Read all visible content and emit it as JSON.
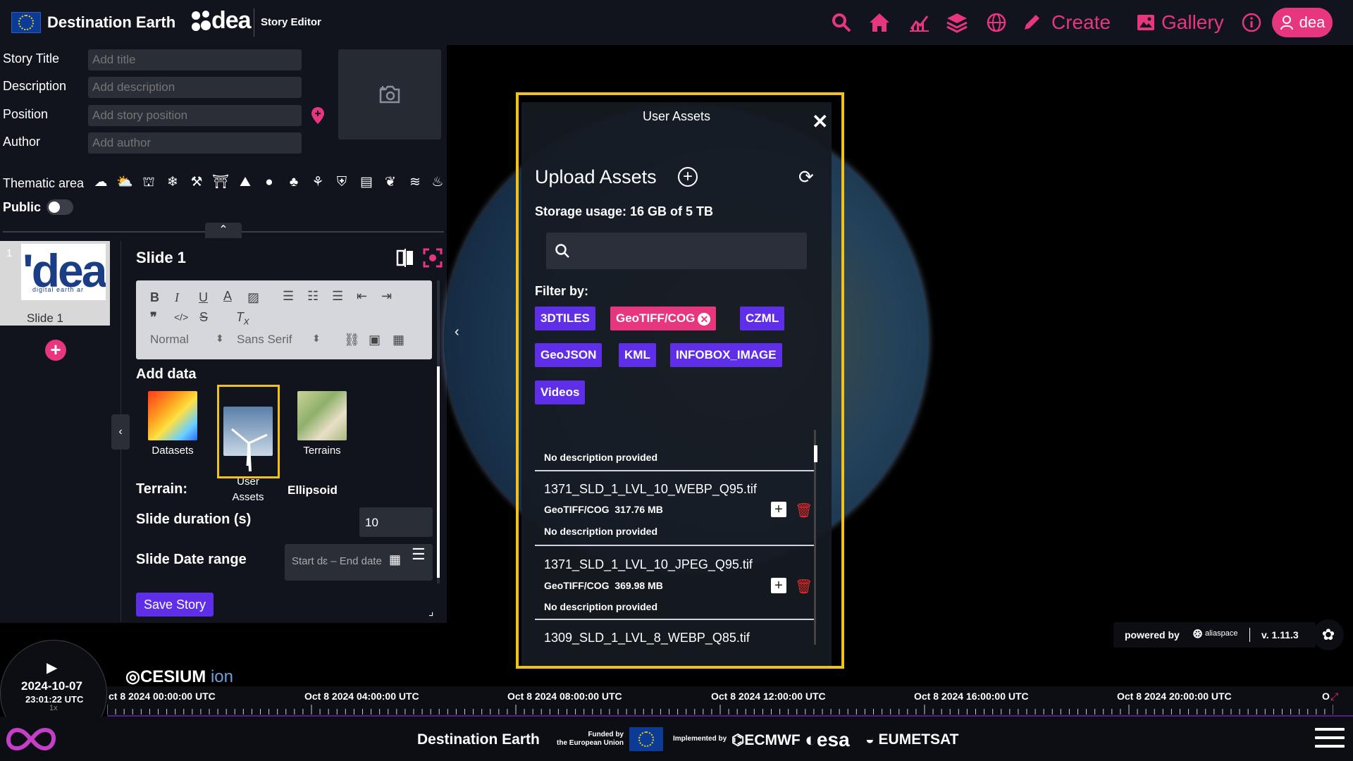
{
  "header": {
    "brand_title": "Destination Earth",
    "logo_text": "dea",
    "app_label": "Story Editor",
    "create_label": "Create",
    "gallery_label": "Gallery",
    "user_label": "dea",
    "accent_color": "#e8367e"
  },
  "story_form": {
    "title_label": "Story Title",
    "title_placeholder": "Add title",
    "description_label": "Description",
    "description_placeholder": "Add description",
    "position_label": "Position",
    "position_placeholder": "Add story position",
    "author_label": "Author",
    "author_placeholder": "Add author",
    "thematic_label": "Thematic area",
    "thematic_icons": [
      "cloud-rain-icon",
      "sun-cloud-icon",
      "tower-icon",
      "snowflake-icon",
      "factory-icon",
      "building-icon",
      "mountain-icon",
      "drop-icon",
      "forest-icon",
      "plant-icon",
      "shield-icon",
      "satellite-icon",
      "leaf-icon",
      "waves-icon",
      "fire-icon"
    ],
    "public_label": "Public",
    "public_enabled": false
  },
  "slides": {
    "items": [
      {
        "number": "1",
        "label": "Slide 1"
      }
    ]
  },
  "slide_editor": {
    "title": "Slide 1",
    "toolbar_format": "Normal",
    "toolbar_font": "Sans Serif",
    "add_data_label": "Add data",
    "data_sources": [
      {
        "label": "Datasets"
      },
      {
        "label": "User\nAssets"
      },
      {
        "label": "Terrains"
      }
    ],
    "terrain_label": "Terrain:",
    "terrain_value": "Ellipsoid",
    "duration_label": "Slide duration (s)",
    "duration_value": "10",
    "date_range_label": "Slide Date range",
    "date_range_placeholder": "Start dɛ – End date",
    "save_label": "Save Story"
  },
  "user_assets_modal": {
    "header": "User Assets",
    "upload_title": "Upload Assets",
    "storage_text": "Storage usage: 16 GB of 5 TB",
    "filter_label": "Filter by:",
    "filters": [
      {
        "label": "3DTILES",
        "active": false
      },
      {
        "label": "GeoTIFF/COG",
        "active": true
      },
      {
        "label": "CZML",
        "active": false
      },
      {
        "label": "GeoJSON",
        "active": false
      },
      {
        "label": "KML",
        "active": false
      },
      {
        "label": "INFOBOX_IMAGE",
        "active": false
      },
      {
        "label": "Videos",
        "active": false
      }
    ],
    "assets": [
      {
        "name": "",
        "type": "",
        "size": "",
        "description": "No description provided"
      },
      {
        "name": "1371_SLD_1_LVL_10_WEBP_Q95.tif",
        "type": "GeoTIFF/COG",
        "size": "317.76 MB",
        "description": "No description provided"
      },
      {
        "name": "1371_SLD_1_LVL_10_JPEG_Q95.tif",
        "type": "GeoTIFF/COG",
        "size": "369.98 MB",
        "description": "No description provided"
      },
      {
        "name": "1309_SLD_1_LVL_8_WEBP_Q85.tif",
        "type": "",
        "size": "",
        "description": ""
      }
    ]
  },
  "powered_by": {
    "label": "powered by",
    "company": "aliaspace",
    "version": "v. 1.11.3"
  },
  "clock": {
    "date": "2024-10-07",
    "time": "23:01:22 UTC",
    "speed": "1x"
  },
  "cesium": {
    "name": "CESIUM",
    "suffix": "ion"
  },
  "timeline": {
    "labels": [
      "ct 8 2024 00:00:00 UTC",
      "Oct 8 2024 04:00:00 UTC",
      "Oct 8 2024 08:00:00 UTC",
      "Oct 8 2024 12:00:00 UTC",
      "Oct 8 2024 16:00:00 UTC",
      "Oct 8 2024 20:00:00 UTC",
      "O"
    ]
  },
  "footer": {
    "title": "Destination Earth",
    "funded_line1": "Funded by",
    "funded_line2": "the European Union",
    "implemented": "Implemented by",
    "ecmwf": "ECMWF",
    "esa": "esa",
    "eumetsat": "EUMETSAT"
  }
}
